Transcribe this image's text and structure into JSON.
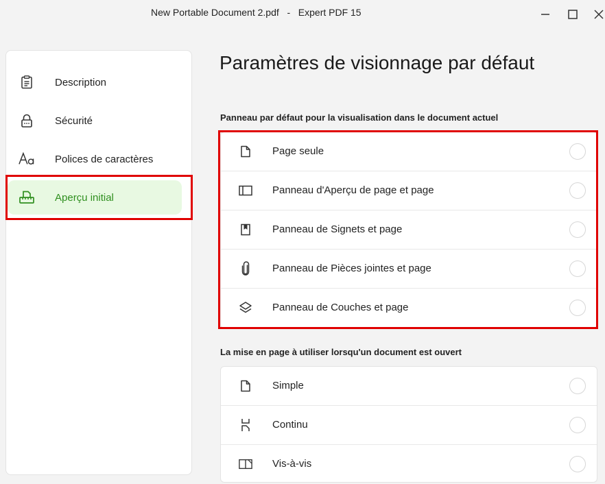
{
  "window": {
    "document_name": "New Portable Document 2.pdf",
    "separator": "-",
    "app_name": "Expert PDF 15",
    "minimize_icon": "minimize-icon",
    "maximize_icon": "maximize-icon",
    "close_icon": "close-icon"
  },
  "sidebar": {
    "items": [
      {
        "label": "Description",
        "icon": "clipboard-icon",
        "active": false
      },
      {
        "label": "Sécurité",
        "icon": "lock-icon",
        "active": false
      },
      {
        "label": "Polices de caractères",
        "icon": "font-icon",
        "active": false
      },
      {
        "label": "Aperçu initial",
        "icon": "printer-ruler-icon",
        "active": true
      }
    ]
  },
  "main": {
    "title": "Paramètres de visionnage par défaut",
    "panel_section": {
      "label": "Panneau par défaut pour la visualisation dans le document actuel",
      "options": [
        {
          "label": "Page seule",
          "icon": "page-icon",
          "selected": false
        },
        {
          "label": "Panneau d'Aperçu de page et page",
          "icon": "sidebar-panel-icon",
          "selected": false
        },
        {
          "label": "Panneau de Signets et page",
          "icon": "bookmark-icon",
          "selected": false
        },
        {
          "label": "Panneau de Pièces jointes et page",
          "icon": "paperclip-icon",
          "selected": false
        },
        {
          "label": "Panneau de Couches et page",
          "icon": "layers-icon",
          "selected": false
        }
      ]
    },
    "layout_section": {
      "label": "La mise en page à utiliser lorsqu'un document est ouvert",
      "options": [
        {
          "label": "Simple",
          "icon": "page-icon",
          "selected": false
        },
        {
          "label": "Continu",
          "icon": "continuous-pages-icon",
          "selected": false
        },
        {
          "label": "Vis-à-vis",
          "icon": "facing-pages-icon",
          "selected": false
        }
      ]
    }
  },
  "colors": {
    "accent": "#2f8f1f",
    "active_background": "#e8f9e2",
    "highlight": "#e00000"
  }
}
